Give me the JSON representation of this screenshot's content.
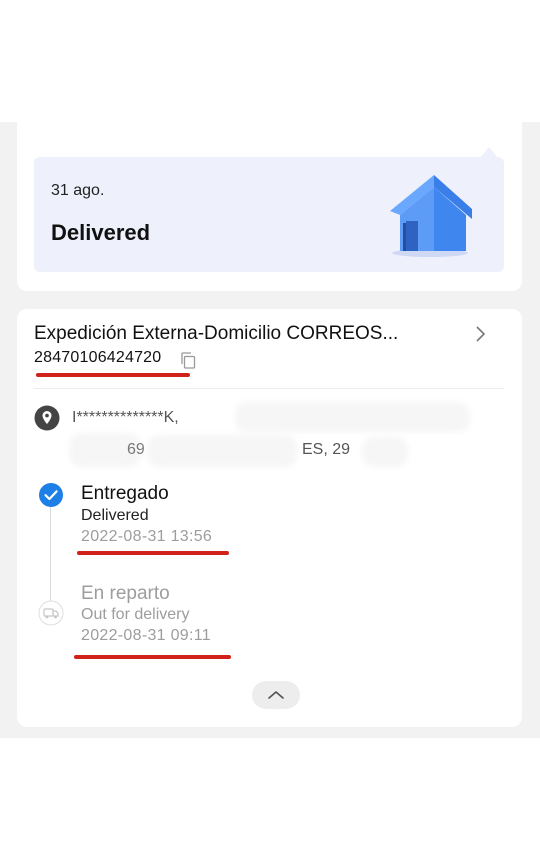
{
  "status_card": {
    "date": "31 ago.",
    "status": "Delivered",
    "illustration": "house-icon"
  },
  "shipment": {
    "carrier_title": "Expedición Externa-Domicilio CORREOS...",
    "tracking_number": "28470106424720",
    "address_line1": "I**************K,",
    "address_line2_fragment": "ES, 29",
    "address_line2_prefix": "69"
  },
  "timeline": [
    {
      "title": "Entregado",
      "subtitle": "Delivered",
      "time": "2022-08-31 13:56",
      "icon": "check-circle-icon",
      "active": true
    },
    {
      "title": "En reparto",
      "subtitle": "Out for delivery",
      "time": "2022-08-31 09:11",
      "icon": "truck-icon",
      "active": false
    }
  ],
  "colors": {
    "accent": "#1e80e6",
    "status_bg": "#eef1fc",
    "highlight_red": "#d0211b",
    "house": "#4a90f0"
  }
}
